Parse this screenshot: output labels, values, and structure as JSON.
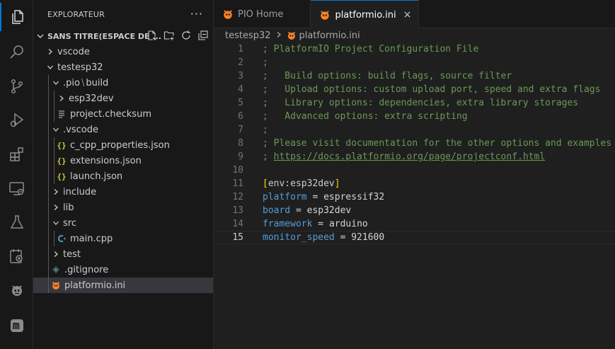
{
  "activity_bar": {
    "icons": [
      "explorer-icon",
      "search-icon",
      "source-control-icon",
      "run-debug-icon",
      "extensions-icon",
      "remote-explorer-icon",
      "testing-icon",
      "unknown-extension-icon",
      "platformio-icon",
      "m-extension-icon"
    ]
  },
  "sidebar": {
    "title": "EXPLORATEUR",
    "more": "···",
    "workspace": "SANS TITRE(ESPACE DE ...",
    "tree": [
      {
        "label": "vscode",
        "kind": "folder-collapsed"
      },
      {
        "label": "testesp32",
        "kind": "folder-open"
      },
      {
        "label": ".pio",
        "label2": "build",
        "kind": "folder-open"
      },
      {
        "label": "esp32dev",
        "kind": "folder-collapsed"
      },
      {
        "label": "project.checksum",
        "kind": "file-lines"
      },
      {
        "label": ".vscode",
        "kind": "folder-open"
      },
      {
        "label": "c_cpp_properties.json",
        "kind": "json"
      },
      {
        "label": "extensions.json",
        "kind": "json"
      },
      {
        "label": "launch.json",
        "kind": "json"
      },
      {
        "label": "include",
        "kind": "folder-collapsed"
      },
      {
        "label": "lib",
        "kind": "folder-collapsed"
      },
      {
        "label": "src",
        "kind": "folder-open"
      },
      {
        "label": "main.cpp",
        "kind": "cpp"
      },
      {
        "label": "test",
        "kind": "folder-collapsed"
      },
      {
        "label": ".gitignore",
        "kind": "git"
      },
      {
        "label": "platformio.ini",
        "kind": "pio"
      }
    ]
  },
  "tabs": [
    {
      "label": "PIO Home",
      "active": false
    },
    {
      "label": "platformio.ini",
      "active": true,
      "close": "×"
    }
  ],
  "breadcrumb": {
    "folder": "testesp32",
    "file": "platformio.ini"
  },
  "editor": {
    "current_line": 15,
    "lines": [
      {
        "n": "1",
        "text": "; PlatformIO Project Configuration File"
      },
      {
        "n": "2",
        "text": ";"
      },
      {
        "n": "3",
        "text": ";   Build options: build flags, source filter"
      },
      {
        "n": "4",
        "text": ";   Upload options: custom upload port, speed and extra flags"
      },
      {
        "n": "5",
        "text": ";   Library options: dependencies, extra library storages"
      },
      {
        "n": "6",
        "text": ";   Advanced options: extra scripting"
      },
      {
        "n": "7",
        "text": ";"
      },
      {
        "n": "8",
        "text": "; Please visit documentation for the other options and examples"
      },
      {
        "n": "9",
        "prefix": "; ",
        "link": "https://docs.platformio.org/page/projectconf.html"
      },
      {
        "n": "10",
        "text": ""
      },
      {
        "n": "11",
        "open": "[",
        "section": "env:esp32dev",
        "close": "]"
      },
      {
        "n": "12",
        "key": "platform",
        "op": " = ",
        "value": "espressif32"
      },
      {
        "n": "13",
        "key": "board",
        "op": " = ",
        "value": "esp32dev"
      },
      {
        "n": "14",
        "key": "framework",
        "op": " = ",
        "value": "arduino"
      },
      {
        "n": "15",
        "key": "monitor_speed",
        "op": " = ",
        "value": "921600"
      }
    ]
  },
  "colors": {
    "accent": "#0078d4",
    "pio_orange": "#f5822a",
    "comment": "#6a9955",
    "key": "#569cd6",
    "json_yellow": "#cbcb41",
    "cpp_blue": "#519aba"
  }
}
